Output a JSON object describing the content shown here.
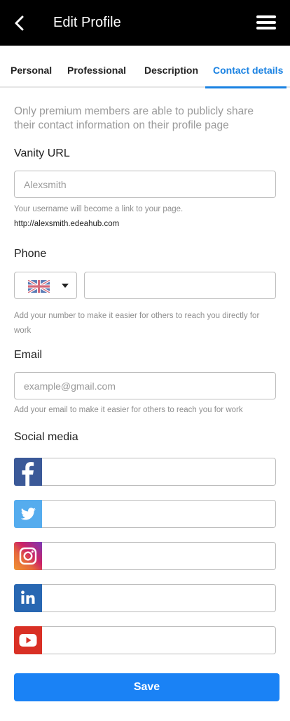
{
  "header": {
    "title": "Edit Profile",
    "back_icon": "chevron-left-icon",
    "menu_icon": "hamburger-menu-icon",
    "background": "#000000"
  },
  "tabs": [
    {
      "label": "Personal",
      "active": false
    },
    {
      "label": "Professional",
      "active": false
    },
    {
      "label": "Description",
      "active": false
    },
    {
      "label": "Contact details",
      "active": true
    }
  ],
  "accent_color": "#1a82e2",
  "intro_text": "Only premium members are able to publicly share their contact information on their profile page",
  "vanity": {
    "label": "Vanity URL",
    "placeholder": "Alexsmith",
    "hint": "Your username will become a link to your page.",
    "url": "http://alexsmith.edeahub.com"
  },
  "phone": {
    "label": "Phone",
    "country_flag": "uk-flag-icon",
    "value": "",
    "hint": "Add your number to make it easier for others to reach you directly for work"
  },
  "email": {
    "label": "Email",
    "placeholder": "example@gmail.com",
    "hint": "Add your email to make it easier for others to reach you for work"
  },
  "social": {
    "label": "Social media",
    "networks": [
      {
        "name": "facebook",
        "icon": "facebook-icon",
        "color": "#3b5998",
        "value": ""
      },
      {
        "name": "twitter",
        "icon": "twitter-icon",
        "color": "#55acee",
        "value": ""
      },
      {
        "name": "instagram",
        "icon": "instagram-icon",
        "color": "#c13584",
        "value": ""
      },
      {
        "name": "linkedin",
        "icon": "linkedin-icon",
        "color": "#2867b2",
        "value": ""
      },
      {
        "name": "youtube",
        "icon": "youtube-icon",
        "color": "#d93025",
        "value": ""
      }
    ]
  },
  "save": {
    "label": "Save",
    "color": "#1a82f5"
  }
}
